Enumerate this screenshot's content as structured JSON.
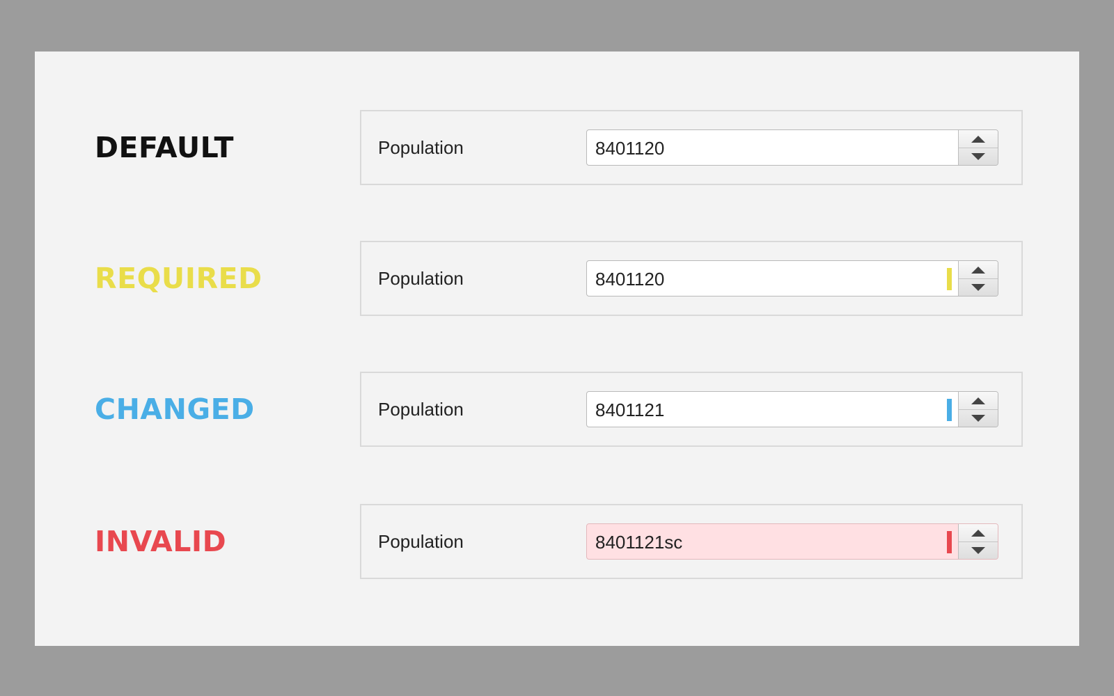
{
  "rows": [
    {
      "state": "DEFAULT",
      "state_color": "#111111",
      "field_label": "Population",
      "value": "8401120",
      "indicator_color": null
    },
    {
      "state": "REQUIRED",
      "state_color": "#e9dd4a",
      "field_label": "Population",
      "value": "8401120",
      "indicator_color": "#e9dd4a"
    },
    {
      "state": "CHANGED",
      "state_color": "#4aaee6",
      "field_label": "Population",
      "value": "8401121",
      "indicator_color": "#4aaee6"
    },
    {
      "state": "INVALID",
      "state_color": "#e8484f",
      "field_label": "Population",
      "value": "8401121sc",
      "indicator_color": "#e8484f"
    }
  ],
  "icons": {
    "increment": "triangle-up-icon",
    "decrement": "triangle-down-icon"
  }
}
